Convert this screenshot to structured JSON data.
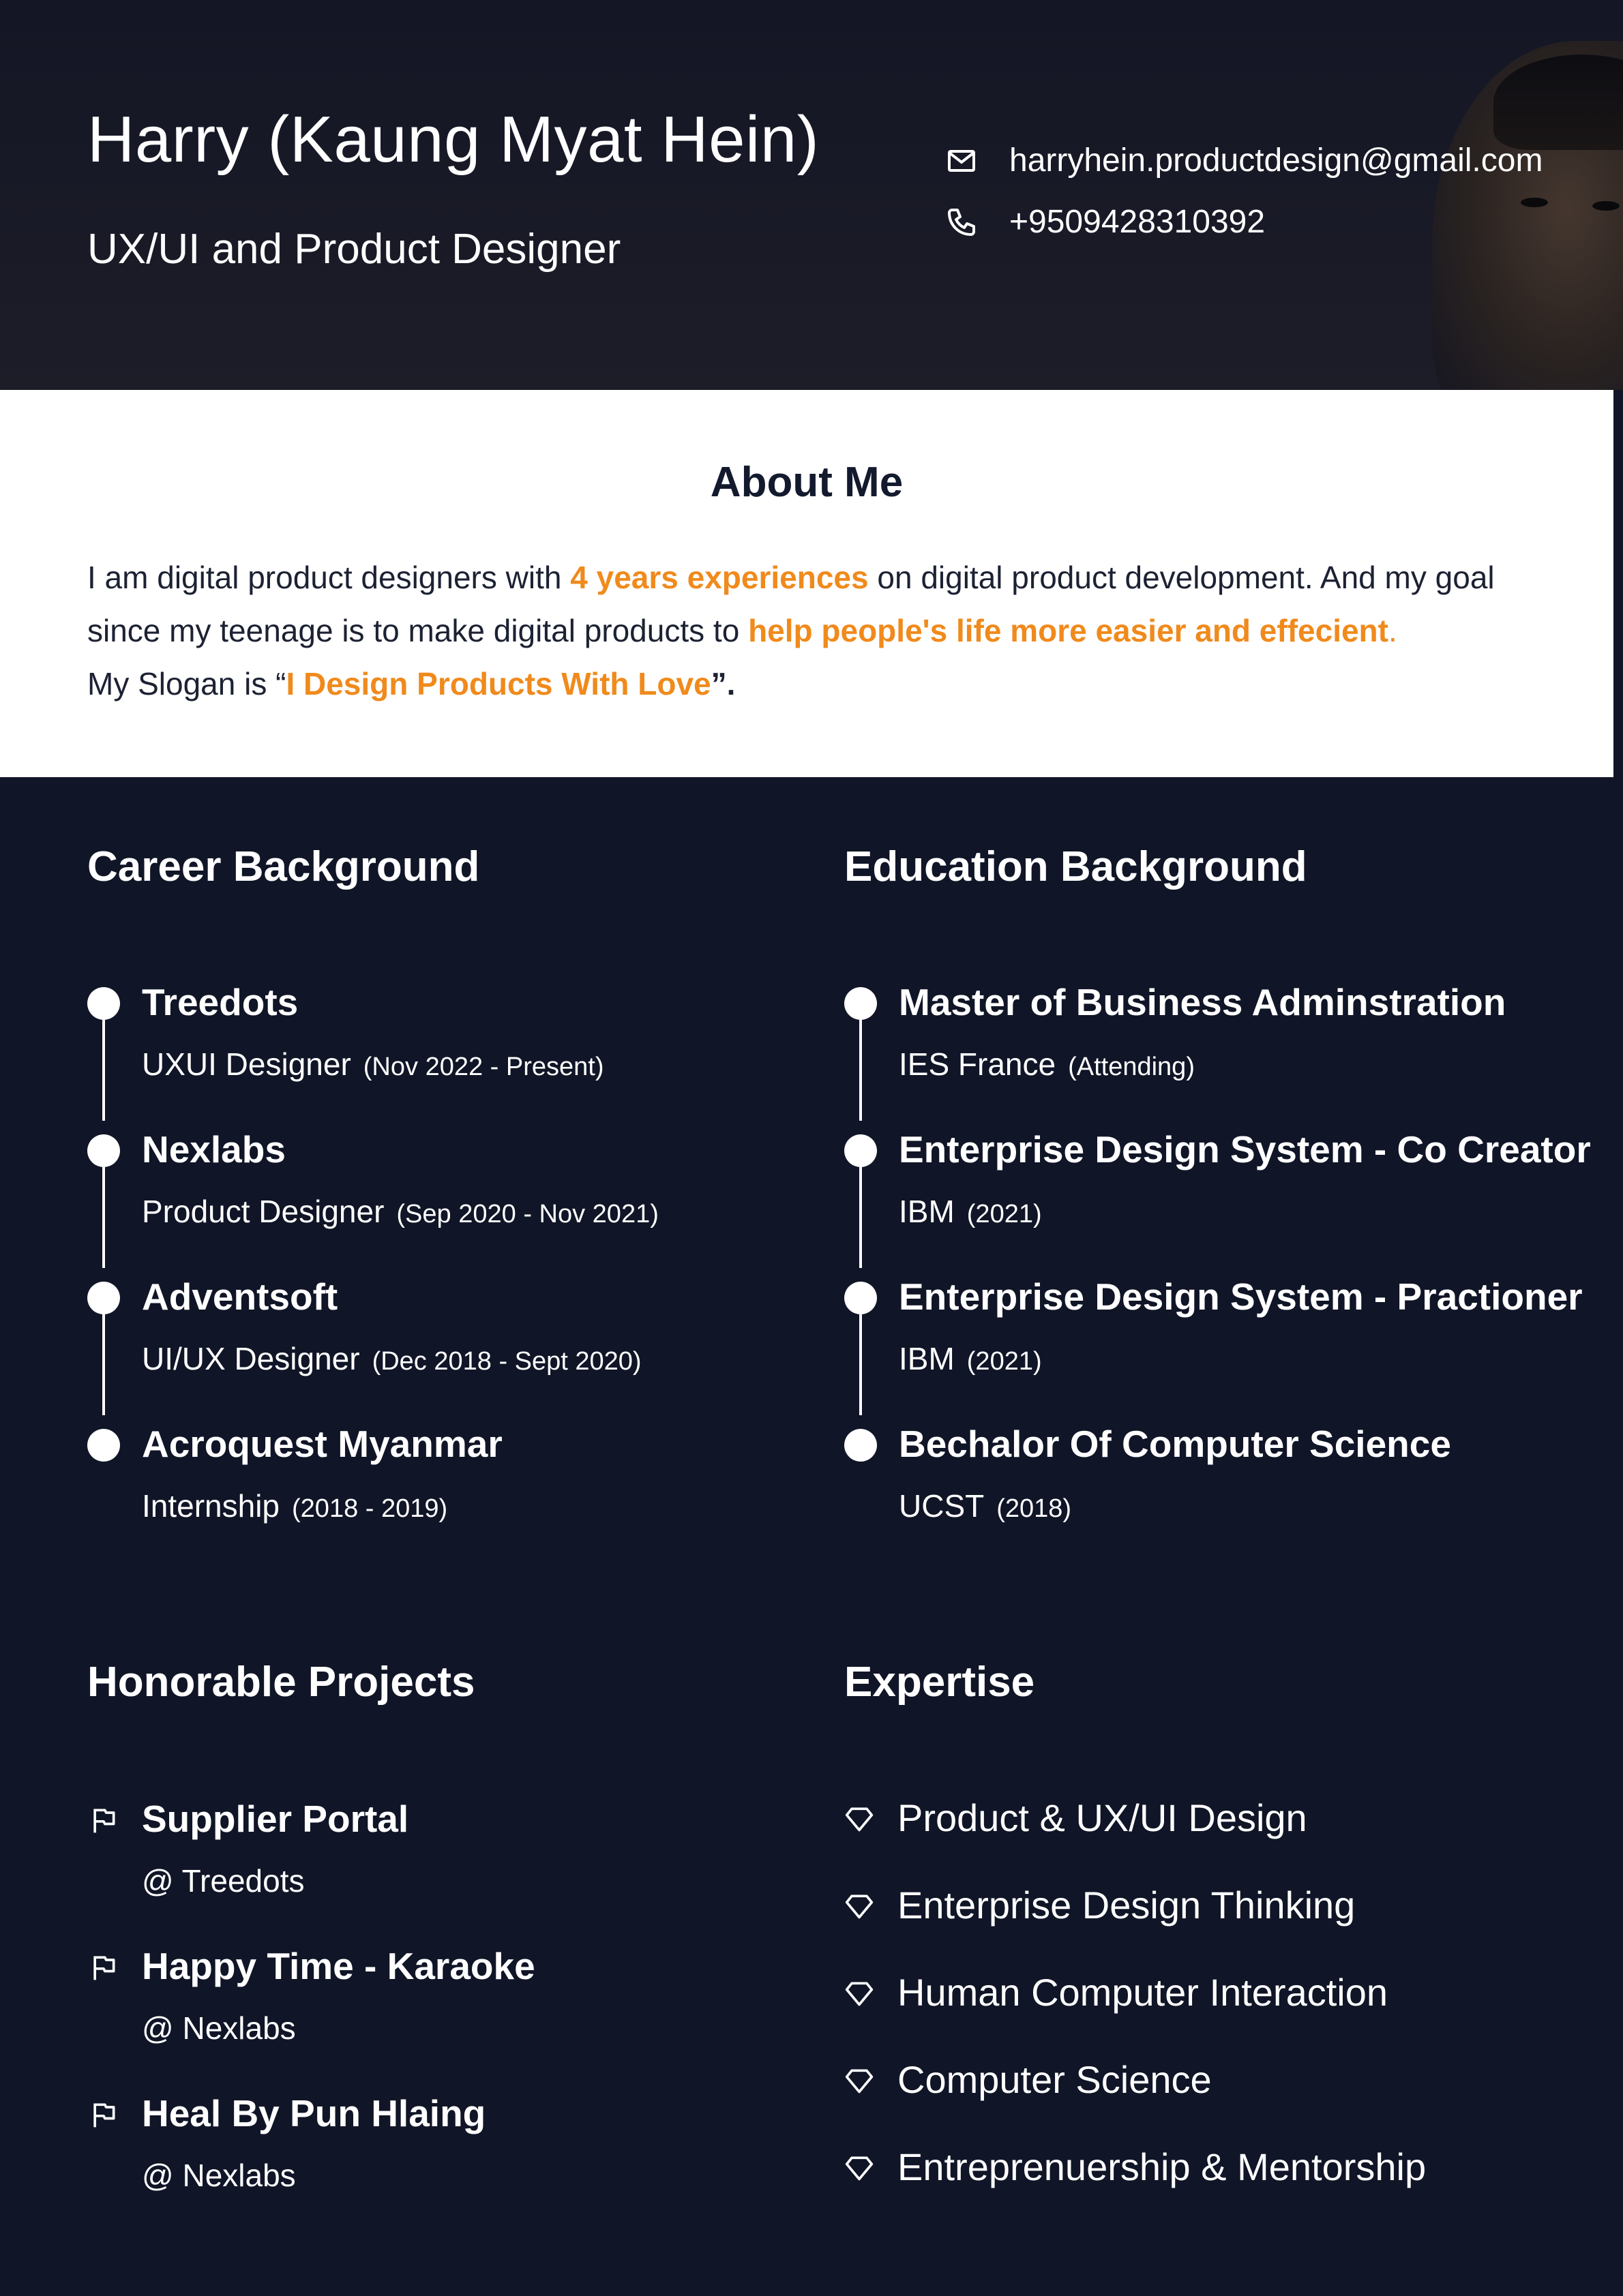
{
  "header": {
    "name": "Harry (Kaung Myat Hein)",
    "role": "UX/UI and Product Designer",
    "email": "harryhein.productdesign@gmail.com",
    "phone": "+9509428310392"
  },
  "about": {
    "title": "About Me",
    "p1": "I am digital product designers with ",
    "h1": "4 years experiences",
    "p2": " on digital product development. And my goal since my teenage is to make digital products to ",
    "h2": "help people's life more easier and effecient",
    "p3": ".",
    "p4": "My Slogan is “",
    "h3": "I Design Products With Love",
    "p5": "”."
  },
  "career": {
    "title": "Career Background",
    "items": [
      {
        "company": "Treedots",
        "role": "UXUI Designer",
        "dates": "(Nov 2022 - Present)"
      },
      {
        "company": "Nexlabs",
        "role": "Product Designer",
        "dates": "(Sep 2020 - Nov 2021)"
      },
      {
        "company": "Adventsoft",
        "role": "UI/UX Designer",
        "dates": "(Dec 2018 - Sept 2020)"
      },
      {
        "company": "Acroquest Myanmar",
        "role": "Internship",
        "dates": "(2018 - 2019)"
      }
    ]
  },
  "education": {
    "title": "Education Background",
    "items": [
      {
        "degree": "Master of Business Adminstration",
        "school": "IES France",
        "dates": "(Attending)"
      },
      {
        "degree": "Enterprise Design System - Co Creator",
        "school": "IBM",
        "dates": "(2021)"
      },
      {
        "degree": "Enterprise Design System - Practioner",
        "school": "IBM",
        "dates": "(2021)"
      },
      {
        "degree": "Bechalor Of Computer Science",
        "school": "UCST",
        "dates": "(2018)"
      }
    ]
  },
  "projects": {
    "title": "Honorable Projects",
    "items": [
      {
        "name": "Supplier Portal",
        "org": "@ Treedots"
      },
      {
        "name": "Happy Time - Karaoke",
        "org": "@ Nexlabs"
      },
      {
        "name": "Heal By Pun Hlaing",
        "org": "@ Nexlabs"
      }
    ]
  },
  "expertise": {
    "title": "Expertise",
    "items": [
      "Product & UX/UI Design",
      "Enterprise Design Thinking",
      "Human Computer Interaction",
      "Computer Science",
      "Entreprenuership & Mentorship"
    ]
  },
  "icons": {
    "email": "mail-icon",
    "phone": "phone-icon",
    "timeline": "timeline-dot",
    "project": "flag-icon",
    "expertise": "diamond-icon"
  },
  "colors": {
    "background": "#101527",
    "accent": "#f08a1c",
    "text": "#ffffff"
  }
}
